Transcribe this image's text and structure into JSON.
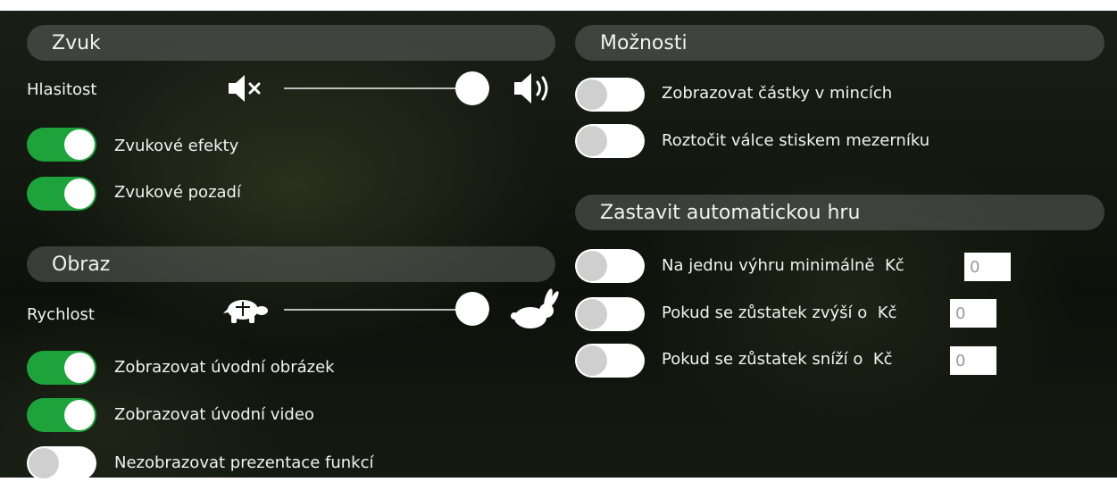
{
  "sound": {
    "header": "Zvuk",
    "volume_label": "Hlasitost",
    "volume_level": 0.95,
    "effects_label": "Zvukové efekty",
    "effects_on": true,
    "background_label": "Zvukové pozadí",
    "background_on": true,
    "icons": {
      "mute": "speaker-mute-icon",
      "loud": "speaker-loud-icon"
    }
  },
  "image": {
    "header": "Obraz",
    "speed_label": "Rychlost",
    "speed_level": 0.95,
    "intro_image_label": "Zobrazovat úvodní obrázek",
    "intro_image_on": true,
    "intro_video_label": "Zobrazovat úvodní video",
    "intro_video_on": true,
    "no_features_label": "Nezobrazovat prezentace funkcí",
    "no_features_on": false,
    "icons": {
      "slow": "turtle-icon",
      "fast": "rabbit-icon"
    }
  },
  "options": {
    "header": "Možnosti",
    "coins_label": "Zobrazovat částky v mincích",
    "coins_on": false,
    "spacebar_label": "Roztočit válce stiskem mezerníku",
    "spacebar_on": false
  },
  "autoplay": {
    "header": "Zastavit automatickou hru",
    "currency": "Kč",
    "win_label": "Na jednu výhru minimálně",
    "win_value": "0",
    "win_on": false,
    "increase_label": "Pokud se zůstatek zvýší o",
    "increase_value": "0",
    "increase_on": false,
    "decrease_label": "Pokud se zůstatek sníží o",
    "decrease_value": "0",
    "decrease_on": false
  },
  "colors": {
    "toggle_on": "#1ea33c",
    "toggle_off": "#ffffff",
    "header_bg": "#787878"
  }
}
